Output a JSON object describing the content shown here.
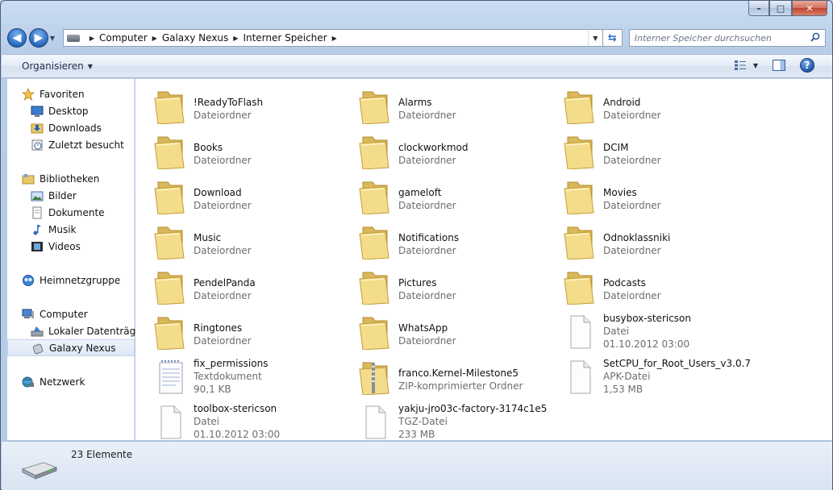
{
  "window": {
    "caption_buttons": {
      "minimize": "–",
      "maximize": "□",
      "close": "✕"
    }
  },
  "address": {
    "crumbs": [
      "Computer",
      "Galaxy Nexus",
      "Interner Speicher"
    ],
    "refresh_icon": "refresh-icon"
  },
  "search": {
    "placeholder": "Interner Speicher durchsuchen"
  },
  "toolbar": {
    "organize_label": "Organisieren"
  },
  "nav": {
    "favorites": {
      "label": "Favoriten",
      "items": [
        "Desktop",
        "Downloads",
        "Zuletzt besucht"
      ]
    },
    "libraries": {
      "label": "Bibliotheken",
      "items": [
        "Bilder",
        "Dokumente",
        "Musik",
        "Videos"
      ]
    },
    "homegroup": {
      "label": "Heimnetzgruppe"
    },
    "computer": {
      "label": "Computer",
      "items": [
        "Lokaler Datenträger",
        "Galaxy Nexus"
      ],
      "selected": "Galaxy Nexus"
    },
    "network": {
      "label": "Netzwerk"
    }
  },
  "files": [
    {
      "name": "!ReadyToFlash",
      "type": "Dateiordner",
      "icon": "folder"
    },
    {
      "name": "Alarms",
      "type": "Dateiordner",
      "icon": "folder"
    },
    {
      "name": "Android",
      "type": "Dateiordner",
      "icon": "folder"
    },
    {
      "name": "Books",
      "type": "Dateiordner",
      "icon": "folder"
    },
    {
      "name": "clockworkmod",
      "type": "Dateiordner",
      "icon": "folder"
    },
    {
      "name": "DCIM",
      "type": "Dateiordner",
      "icon": "folder"
    },
    {
      "name": "Download",
      "type": "Dateiordner",
      "icon": "folder"
    },
    {
      "name": "gameloft",
      "type": "Dateiordner",
      "icon": "folder"
    },
    {
      "name": "Movies",
      "type": "Dateiordner",
      "icon": "folder"
    },
    {
      "name": "Music",
      "type": "Dateiordner",
      "icon": "folder"
    },
    {
      "name": "Notifications",
      "type": "Dateiordner",
      "icon": "folder"
    },
    {
      "name": "Odnoklassniki",
      "type": "Dateiordner",
      "icon": "folder"
    },
    {
      "name": "PendelPanda",
      "type": "Dateiordner",
      "icon": "folder"
    },
    {
      "name": "Pictures",
      "type": "Dateiordner",
      "icon": "folder"
    },
    {
      "name": "Podcasts",
      "type": "Dateiordner",
      "icon": "folder"
    },
    {
      "name": "Ringtones",
      "type": "Dateiordner",
      "icon": "folder"
    },
    {
      "name": "WhatsApp",
      "type": "Dateiordner",
      "icon": "folder"
    },
    {
      "name": "busybox-stericson",
      "type": "Datei",
      "meta": "01.10.2012 03:00",
      "icon": "file"
    },
    {
      "name": "fix_permissions",
      "type": "Textdokument",
      "meta": "90,1 KB",
      "icon": "text"
    },
    {
      "name": "franco.Kernel-Milestone5",
      "type": "ZIP-komprimierter Ordner",
      "icon": "zip"
    },
    {
      "name": "SetCPU_for_Root_Users_v3.0.7",
      "type": "APK-Datei",
      "meta": "1,53 MB",
      "icon": "file"
    },
    {
      "name": "toolbox-stericson",
      "type": "Datei",
      "meta": "01.10.2012 03:00",
      "icon": "file"
    },
    {
      "name": "yakju-jro03c-factory-3174c1e5",
      "type": "TGZ-Datei",
      "meta": "233 MB",
      "icon": "file"
    }
  ],
  "status": {
    "count_text": "23 Elemente"
  }
}
